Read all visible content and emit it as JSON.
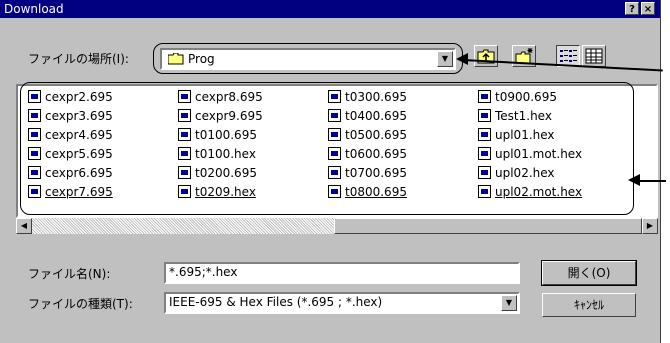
{
  "window": {
    "title": "Download",
    "help_label": "?",
    "close_label": "×"
  },
  "look_in": {
    "label": "ファイルの場所(I):",
    "value": "Prog"
  },
  "toolbar": {
    "up_folder": "up-folder-icon",
    "new_folder": "new-folder-icon",
    "list_view": "list-view-icon",
    "details_view": "details-view-icon"
  },
  "files": {
    "col1": [
      "cexpr2.695",
      "cexpr3.695",
      "cexpr4.695",
      "cexpr5.695",
      "cexpr6.695",
      "cexpr7.695"
    ],
    "col2": [
      "cexpr8.695",
      "cexpr9.695",
      "t0100.695",
      "t0100.hex",
      "t0200.695",
      "t0209.hex"
    ],
    "col3": [
      "t0300.695",
      "t0400.695",
      "t0500.695",
      "t0600.695",
      "t0700.695",
      "t0800.695"
    ],
    "col4": [
      "t0900.695",
      "Test1.hex",
      "upl01.hex",
      "upl01.mot.hex",
      "upl02.hex",
      "upl02.mot.hex"
    ]
  },
  "filename": {
    "label": "ファイル名(N):",
    "value": "*.695;*.hex"
  },
  "filetype": {
    "label": "ファイルの種類(T):",
    "value": "IEEE-695 & Hex Files (*.695 ; *.hex)"
  },
  "buttons": {
    "open": "開く(O)",
    "cancel": "ｷｬﾝｾﾙ"
  },
  "colors": {
    "titlebar": "#000080",
    "face": "#c0c0c0",
    "window": "#ffffff"
  }
}
